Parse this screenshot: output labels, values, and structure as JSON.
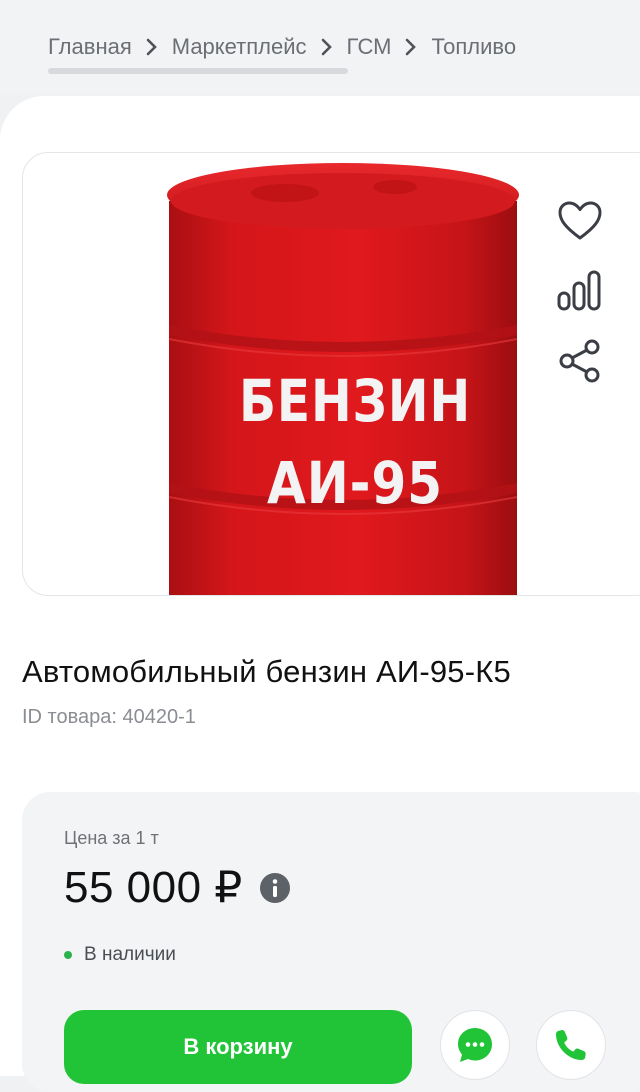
{
  "breadcrumb": {
    "items": [
      "Главная",
      "Маркетплейс",
      "ГСМ",
      "Топливо"
    ]
  },
  "product": {
    "title": "Автомобильный бензин АИ-95-К5",
    "id_label": "ID товара: 40420-1",
    "image_text_line1": "БЕНЗИН",
    "image_text_line2": "АИ-95",
    "barrel_color": "#d9191c"
  },
  "pricing": {
    "price_label": "Цена за 1 т",
    "price": "55 000 ₽",
    "stock": "В наличии",
    "stock_color": "#2bb24c"
  },
  "buttons": {
    "cart": "В корзину",
    "cart_color": "#22c437"
  },
  "icons": {
    "favorite": "heart-icon",
    "compare": "compare-bars-icon",
    "share": "share-icon",
    "info": "info-icon",
    "chat": "chat-icon",
    "call": "phone-icon"
  }
}
